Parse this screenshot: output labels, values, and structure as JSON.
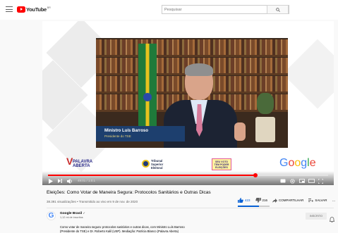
{
  "header": {
    "logo_text": "YouTube",
    "country_code": "BR",
    "search_placeholder": "Pesquisar"
  },
  "video": {
    "lower_third": {
      "name": "Ministro Luís Barroso",
      "role": "Presidente do TSE"
    },
    "sponsors": {
      "logo1_mark": "V",
      "logo1_line1": "PALAVRA",
      "logo1_line2": "ABERTA",
      "logo2_line1": "Tribunal",
      "logo2_line2": "Superior",
      "logo2_line3": "Eleitoral",
      "logo3_line1": "SEU VOTO",
      "logo3_line2": "TEM PODER",
      "logo3_line3": "ELEIÇÕES",
      "logo4_letters": [
        "G",
        "o",
        "o",
        "g",
        "l",
        "e"
      ]
    },
    "time_display": "49:01 / 1:0:1",
    "progress_fraction": 0.74
  },
  "info": {
    "title": "Eleições: Como Votar de Maneira Segura: Protocolos Sanitários e Outras Dicas",
    "views_date": "38.391 visualizações • Transmitido ao vivo em 9 de nov. de 2020",
    "likes": "423",
    "dislikes": "216",
    "share_label": "COMPARTILHAR",
    "save_label": "SALVAR",
    "more_label": "...",
    "like_ratio": 0.66
  },
  "channel": {
    "avatar_letter": "G",
    "name": "Google Brasil",
    "verified_mark": "✓",
    "subscribers": "1,12 mi de inscritos",
    "subscribed_label": "INSCRITO",
    "description_line1": "Como votar de maneira segura: protocolos sanitários e outras dicas, com Ministro Luís Barroso",
    "description_line2": "(Presidente do TSE) e Dr. Roberto Kalil (USP). Mediação: Patrícia Blanco (Palavra Aberta)"
  },
  "colors": {
    "brand_red": "#ff0000",
    "link_blue": "#065fd4"
  }
}
